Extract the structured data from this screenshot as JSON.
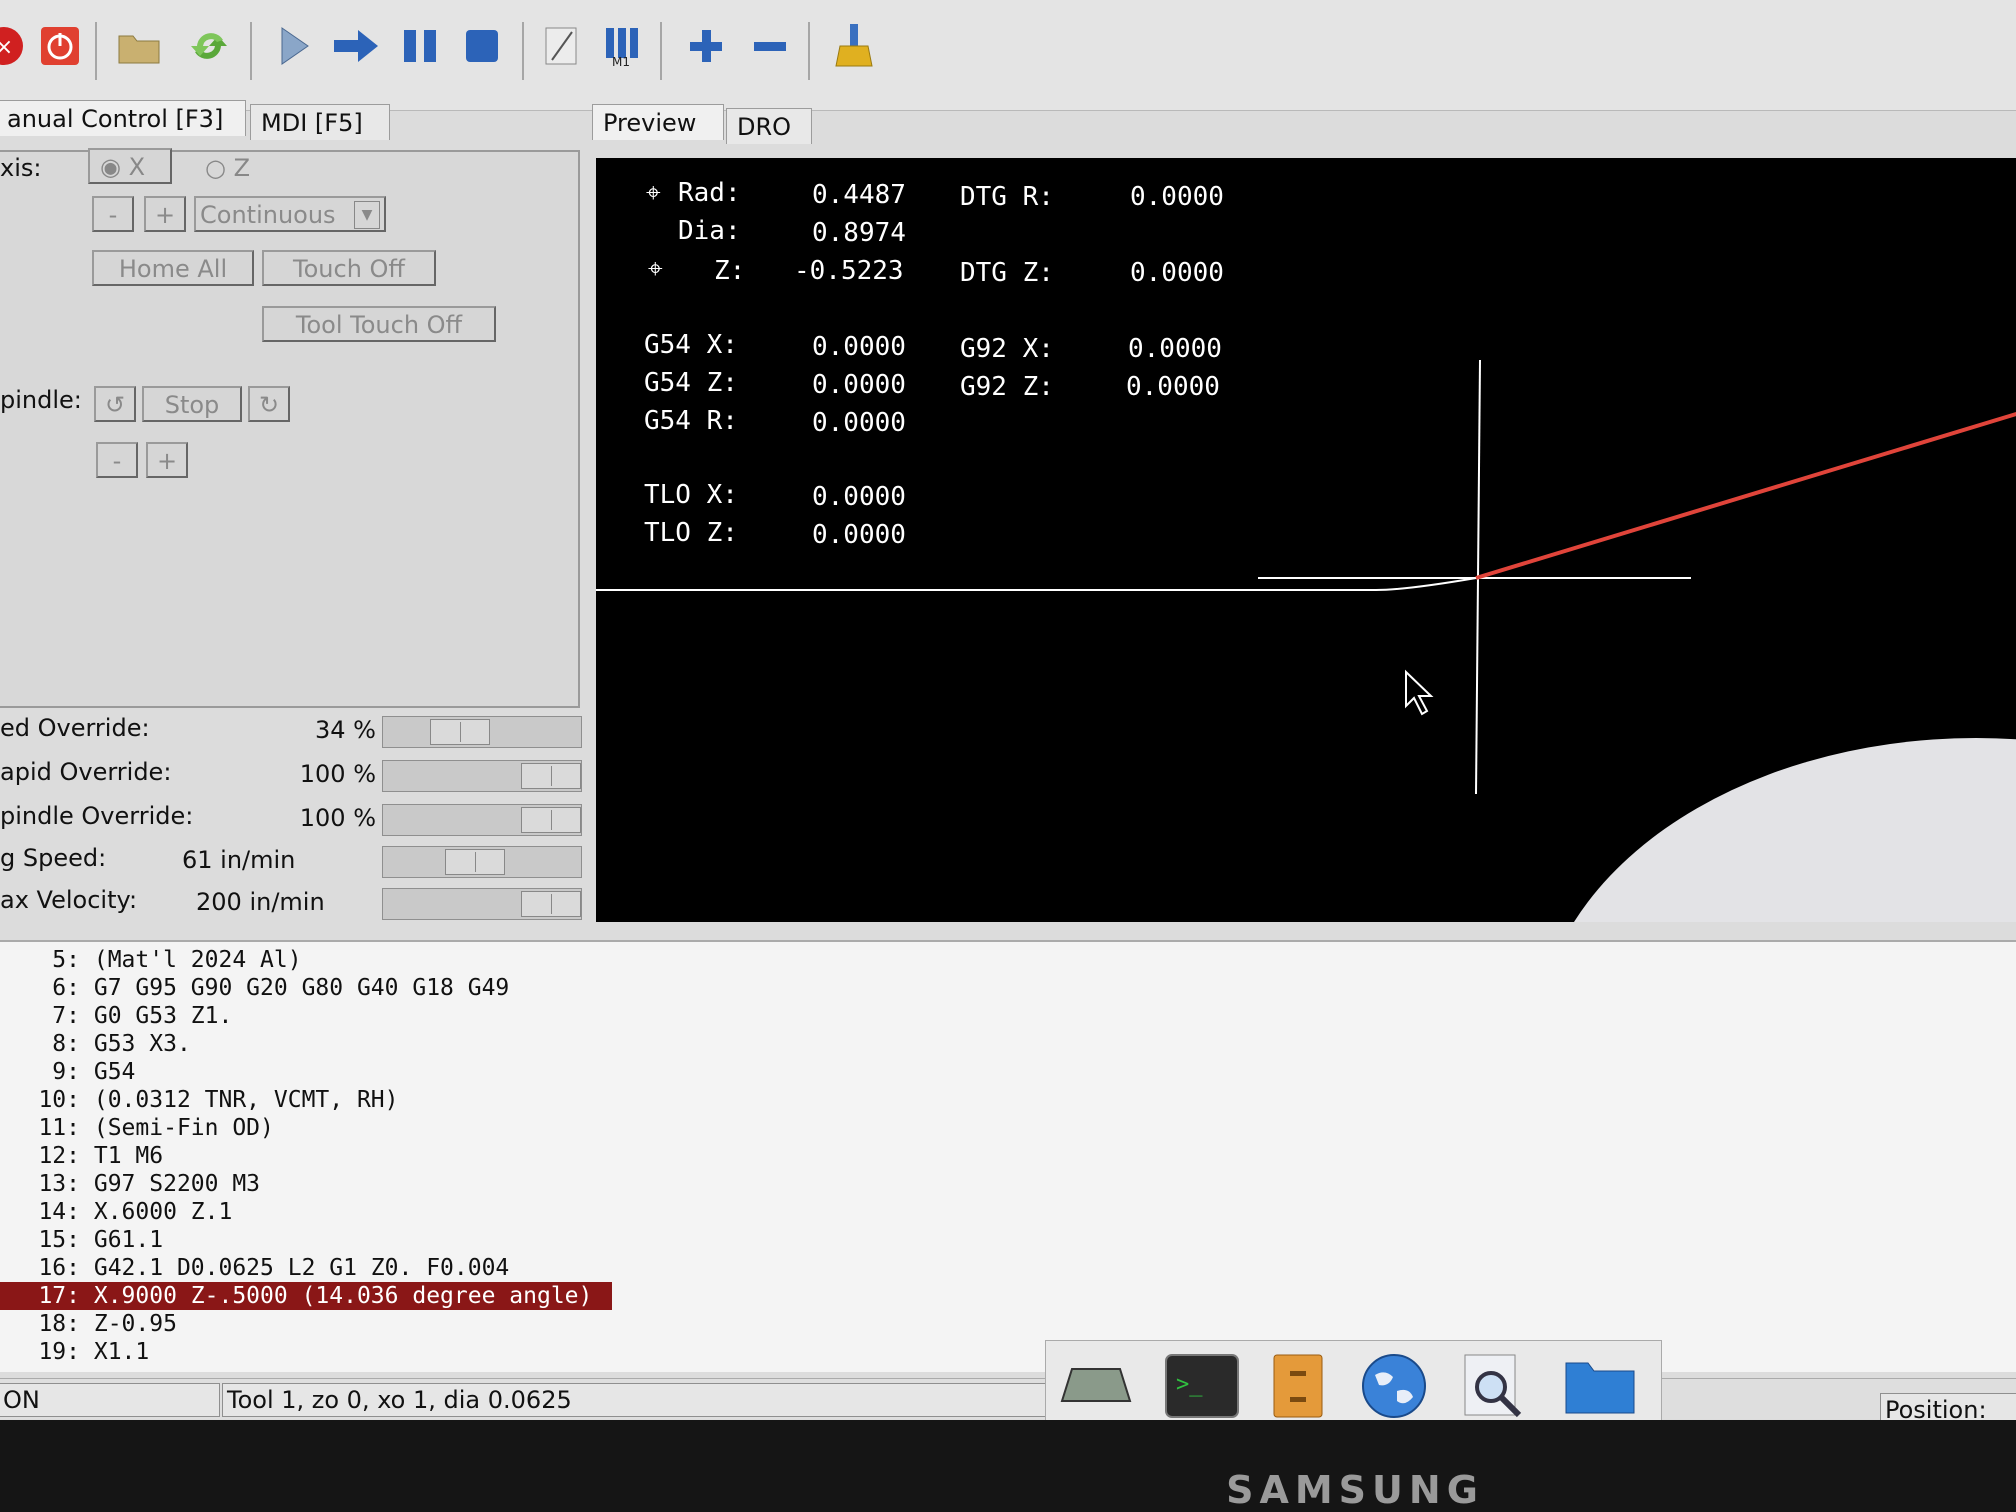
{
  "tabs": {
    "manual": "anual Control [F3]",
    "mdi": "MDI [F5]",
    "preview": "Preview",
    "dro": "DRO"
  },
  "manual": {
    "axis_label": "xis:",
    "axis_x": "X",
    "axis_z": "Z",
    "jog_minus": "-",
    "jog_plus": "+",
    "jog_mode": "Continuous",
    "home_all": "Home All",
    "touch_off": "Touch Off",
    "tool_touch_off": "Tool Touch Off",
    "spindle_label": "pindle:",
    "spindle_stop": "Stop",
    "spindle_minus": "-",
    "spindle_plus": "+"
  },
  "overrides": [
    {
      "label": "ed Override:",
      "value": "34 %",
      "level": 0.34
    },
    {
      "label": "apid Override:",
      "value": "100 %",
      "level": 1.0
    },
    {
      "label": "pindle Override:",
      "value": "100 %",
      "level": 1.0
    },
    {
      "label": "g Speed:",
      "value": "61 in/min",
      "level": 0.45
    },
    {
      "label": "ax Velocity:",
      "value": "200 in/min",
      "level": 1.0
    }
  ],
  "dro": {
    "rad_label": "Rad:",
    "rad_value": "0.4487",
    "dtg_r_label": "DTG R:",
    "dtg_r_value": "0.0000",
    "dia_label": "Dia:",
    "dia_value": "0.8974",
    "z_label": "Z:",
    "z_value": "-0.5223",
    "dtg_z_label": "DTG Z:",
    "dtg_z_value": "0.0000",
    "g54x_label": "G54 X:",
    "g54x_value": "0.0000",
    "g92x_label": "G92 X:",
    "g92x_value": "0.0000",
    "g54z_label": "G54 Z:",
    "g54z_value": "0.0000",
    "g92z_label": "G92 Z:",
    "g92z_value": "0.0000",
    "g54r_label": "G54 R:",
    "g54r_value": "0.0000",
    "tlox_label": "TLO X:",
    "tlox_value": "0.0000",
    "tloz_label": "TLO Z:",
    "tloz_value": "0.0000"
  },
  "gcode": [
    {
      "n": "5:",
      "text": "(Mat'l 2024 Al)"
    },
    {
      "n": "6:",
      "text": "G7 G95 G90 G20 G80 G40 G18 G49"
    },
    {
      "n": "7:",
      "text": "G0 G53 Z1."
    },
    {
      "n": "8:",
      "text": "G53 X3."
    },
    {
      "n": "9:",
      "text": "G54"
    },
    {
      "n": "10:",
      "text": "(0.0312 TNR, VCMT, RH)"
    },
    {
      "n": "11:",
      "text": "(Semi-Fin OD)"
    },
    {
      "n": "12:",
      "text": "T1 M6"
    },
    {
      "n": "13:",
      "text": "G97 S2200 M3"
    },
    {
      "n": "14:",
      "text": "X.6000 Z.1"
    },
    {
      "n": "15:",
      "text": "G61.1"
    },
    {
      "n": "16:",
      "text": "G42.1 D0.0625 L2 G1 Z0. F0.004"
    },
    {
      "n": "17:",
      "text": "X.9000 Z-.5000 (14.036 degree angle)"
    },
    {
      "n": "18:",
      "text": "Z-0.95"
    },
    {
      "n": "19:",
      "text": "X1.1"
    }
  ],
  "status": {
    "state": "ON",
    "tool": "Tool 1, zo 0, xo 1, dia 0.0625",
    "position": "Position: Re"
  },
  "brand": "SAMSUNG",
  "colors": {
    "highlight": "#8a1717",
    "toolpath": "#e0443a",
    "preview_bg": "#000000"
  }
}
